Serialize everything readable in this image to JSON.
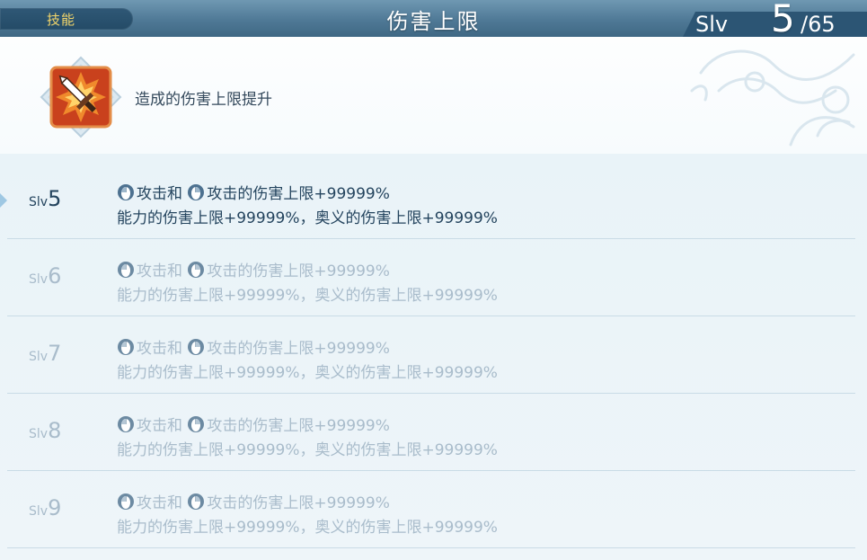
{
  "header": {
    "tab_label": "技能",
    "title": "伤害上限",
    "slv_label": "Slv",
    "slv_current": "5",
    "slv_max": "/65"
  },
  "skill": {
    "icon": "sword-burst-icon",
    "description": "造成的伤害上限提升"
  },
  "levels": [
    {
      "slv_prefix": "Slv",
      "level": "5",
      "line1_a": "攻击和",
      "line1_b": "攻击的伤害上限+99999%",
      "line2": "能力的伤害上限+99999%，奥义的伤害上限+99999%",
      "active": true
    },
    {
      "slv_prefix": "Slv",
      "level": "6",
      "line1_a": "攻击和",
      "line1_b": "攻击的伤害上限+99999%",
      "line2": "能力的伤害上限+99999%，奥义的伤害上限+99999%",
      "active": false
    },
    {
      "slv_prefix": "Slv",
      "level": "7",
      "line1_a": "攻击和",
      "line1_b": "攻击的伤害上限+99999%",
      "line2": "能力的伤害上限+99999%，奥义的伤害上限+99999%",
      "active": false
    },
    {
      "slv_prefix": "Slv",
      "level": "8",
      "line1_a": "攻击和",
      "line1_b": "攻击的伤害上限+99999%",
      "line2": "能力的伤害上限+99999%，奥义的伤害上限+99999%",
      "active": false
    },
    {
      "slv_prefix": "Slv",
      "level": "9",
      "line1_a": "攻击和",
      "line1_b": "攻击的伤害上限+99999%",
      "line2": "能力的伤害上限+99999%，奥义的伤害上限+99999%",
      "active": false
    }
  ],
  "colors": {
    "header": "#4f7996",
    "tab_text": "#f2d56a",
    "active_text": "#24445e",
    "inactive_text": "#a9bccb"
  }
}
